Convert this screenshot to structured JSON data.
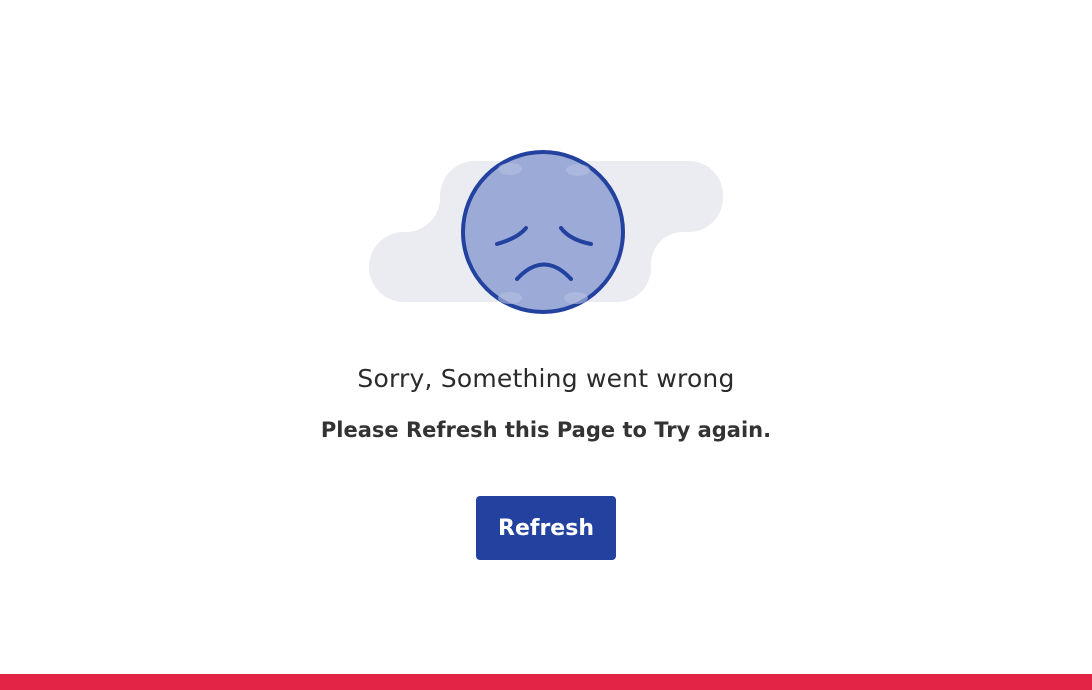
{
  "illustration": {
    "icon": "sad-face-icon",
    "cloud_color": "#ebecf1",
    "face_fill": "#9baad6",
    "face_stroke": "#2342a0"
  },
  "error": {
    "title": "Sorry, Something went wrong",
    "message": "Please Refresh this Page to Try again."
  },
  "actions": {
    "refresh_label": "Refresh",
    "button_color": "#2342a0"
  },
  "footer": {
    "bar_color": "#e32446"
  }
}
